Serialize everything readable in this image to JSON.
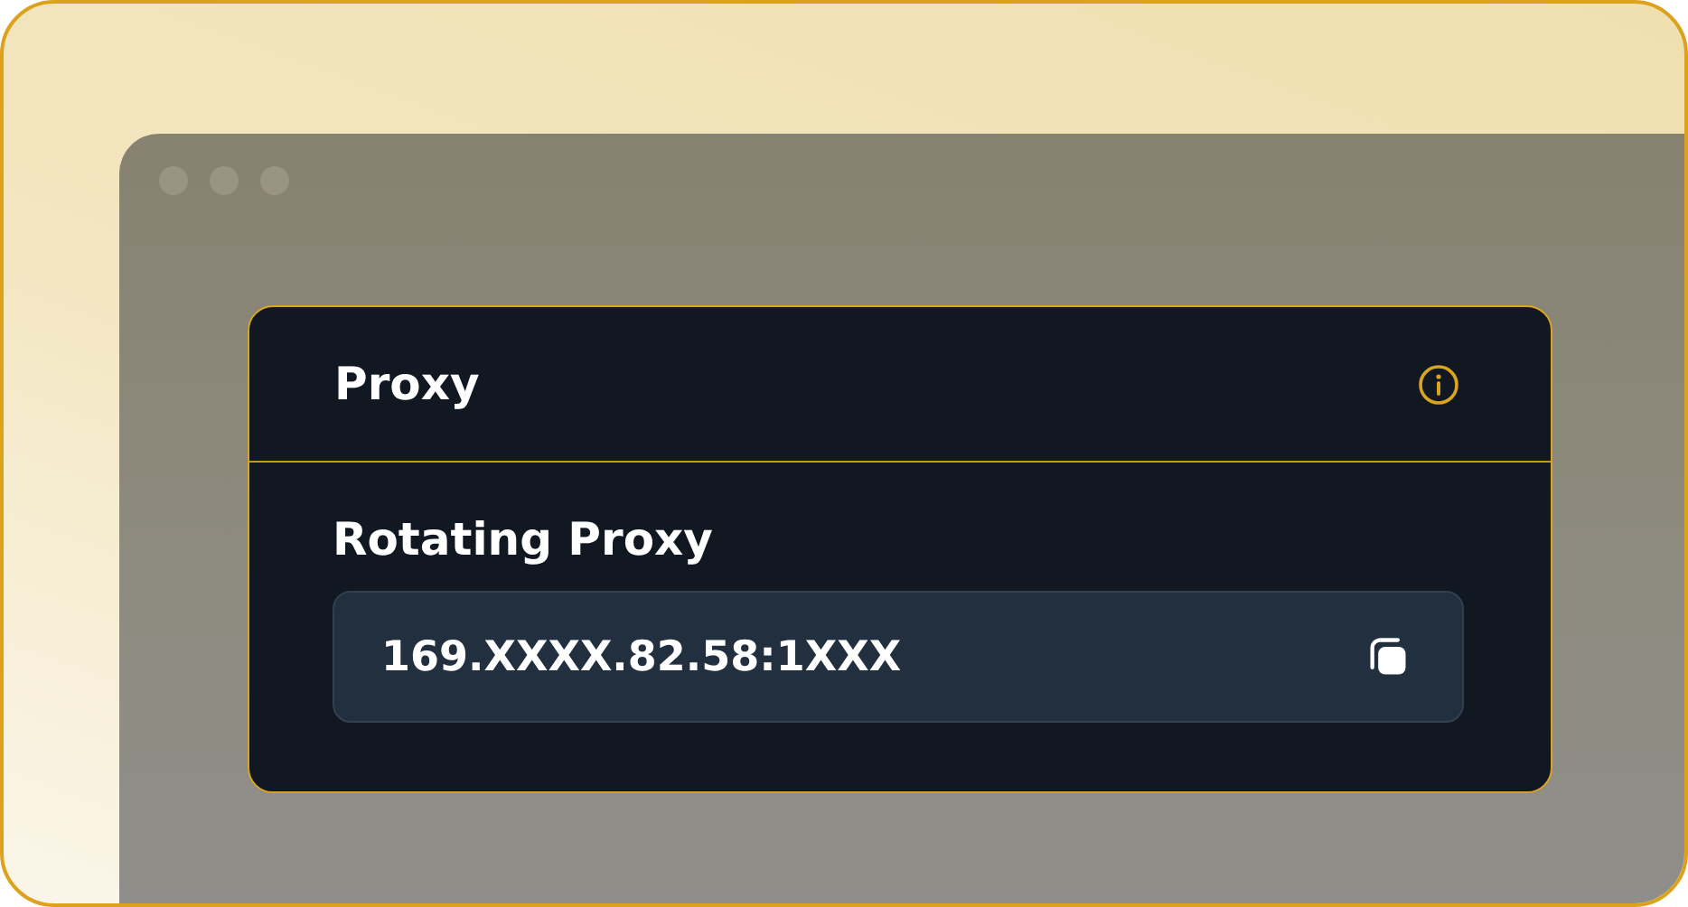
{
  "card": {
    "title": "Proxy"
  },
  "field": {
    "label": "Rotating Proxy",
    "value": "169.XXXX.82.58:1XXX"
  }
}
